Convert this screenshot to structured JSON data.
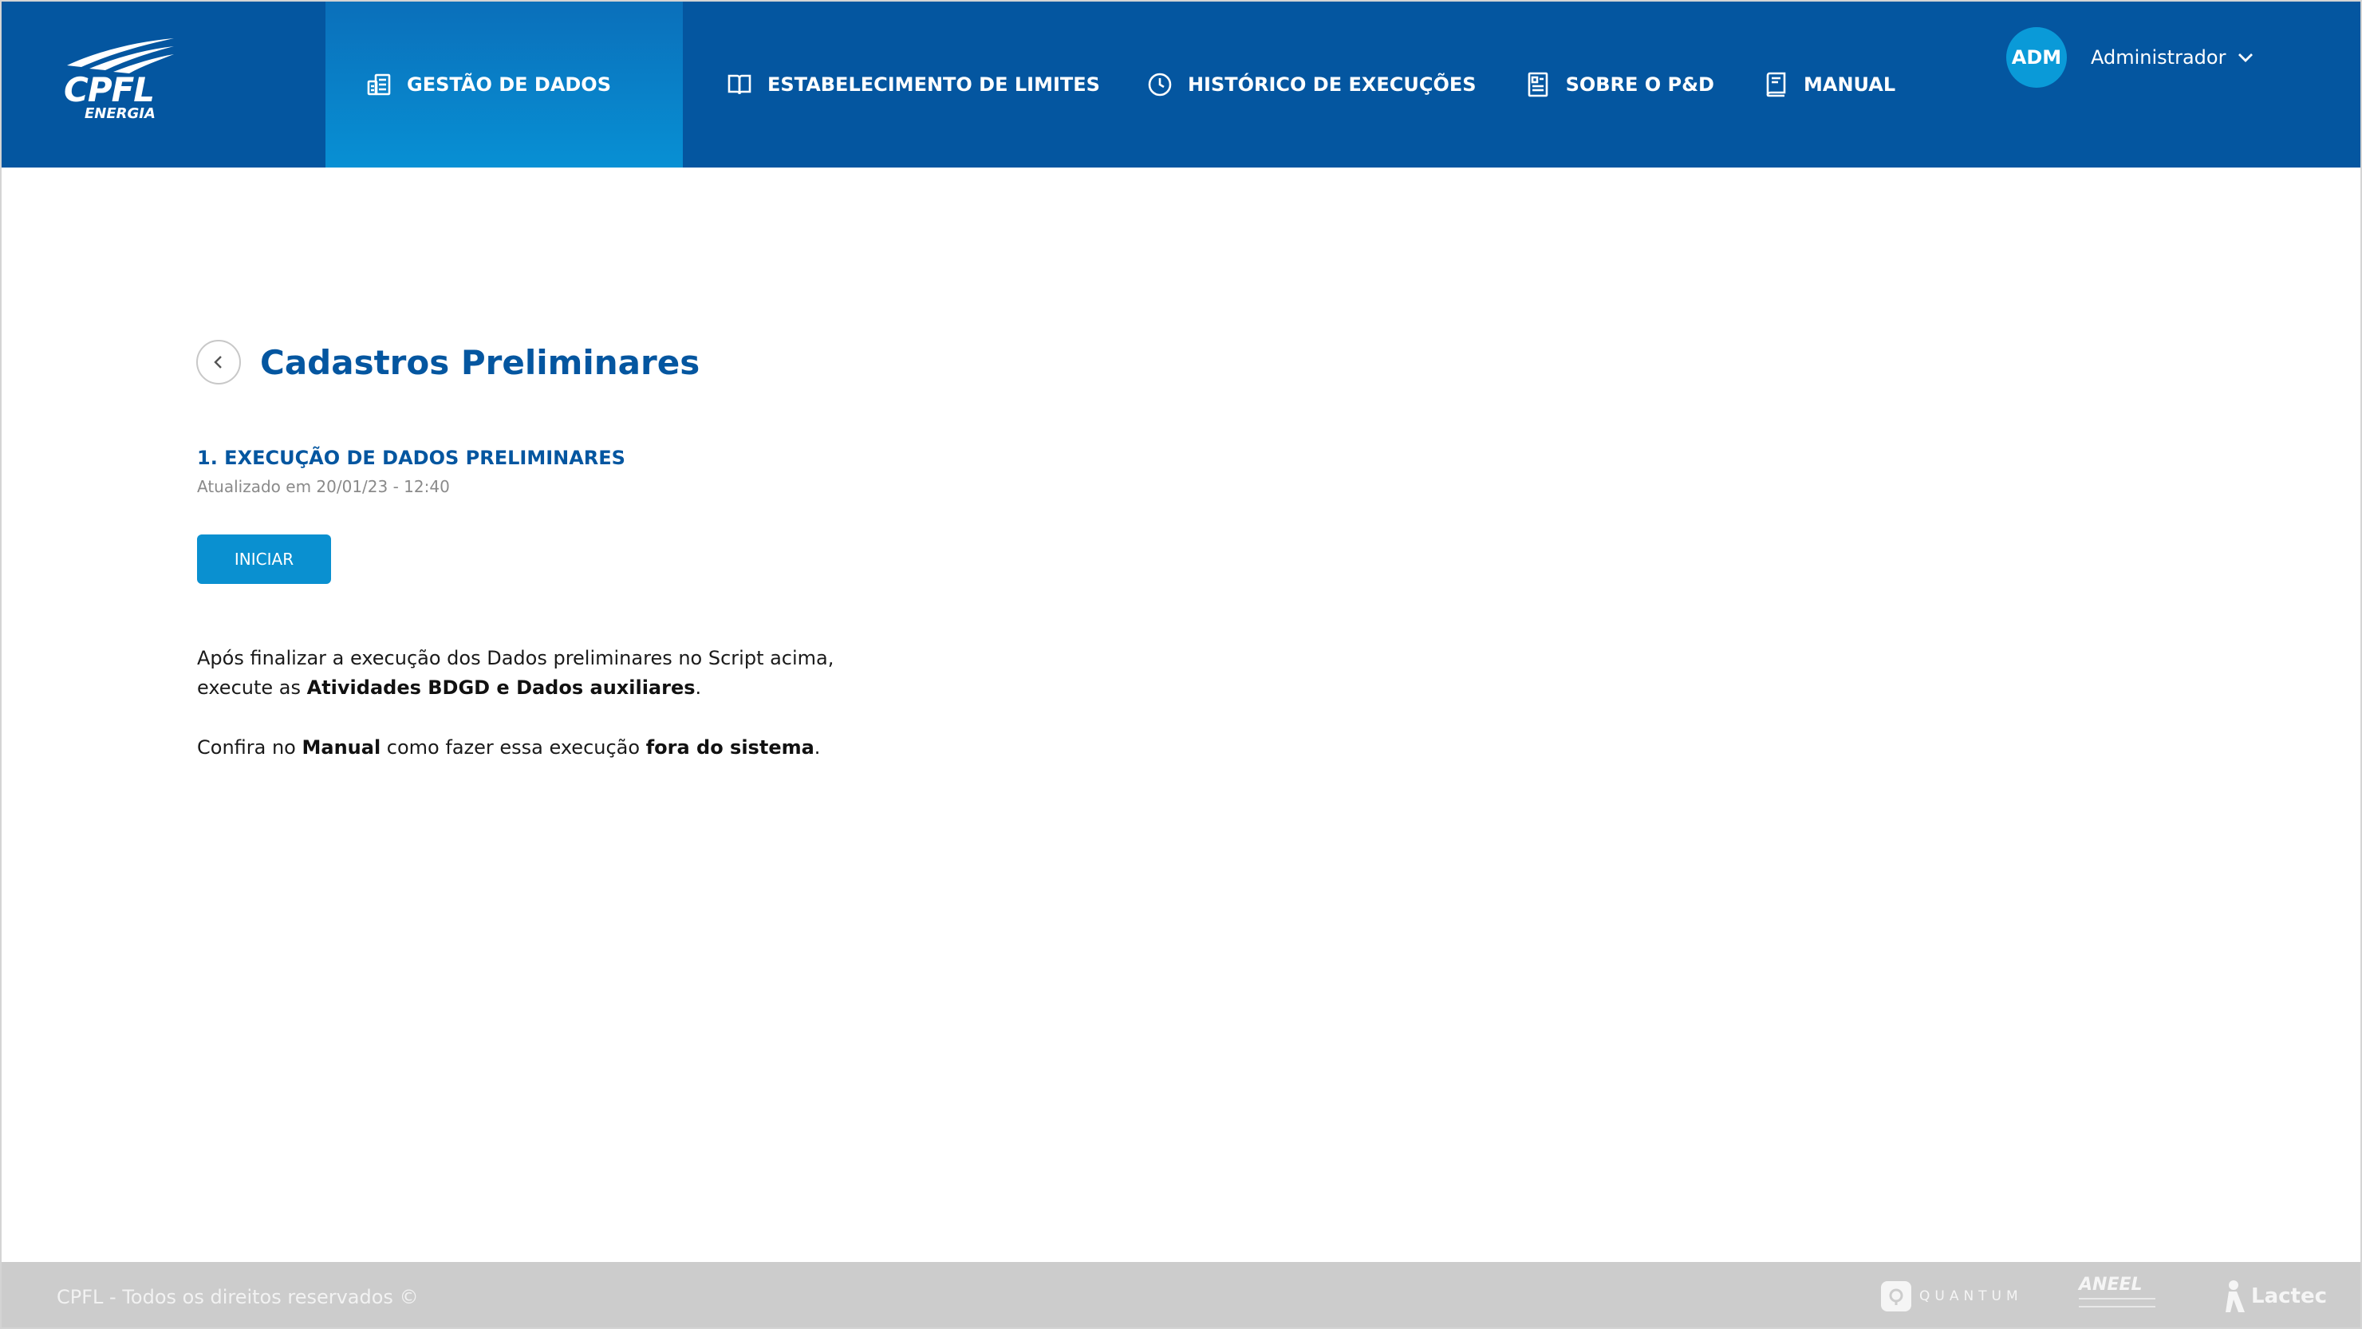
{
  "header": {
    "logo": {
      "main": "CPFL",
      "sub": "ENERGIA"
    },
    "nav": [
      {
        "label": "GESTÃO DE DADOS",
        "icon": "data-management-icon",
        "active": true
      },
      {
        "label": "ESTABELECIMENTO DE LIMITES",
        "icon": "book-open-icon",
        "active": false
      },
      {
        "label": "HISTÓRICO DE EXECUÇÕES",
        "icon": "clock-icon",
        "active": false
      },
      {
        "label": "SOBRE O P&D",
        "icon": "document-icon",
        "active": false
      },
      {
        "label": "MANUAL",
        "icon": "manual-book-icon",
        "active": false
      }
    ],
    "user": {
      "initials": "ADM",
      "name": "Administrador",
      "icon": "chevron-down-icon"
    }
  },
  "main": {
    "title": "Cadastros Preliminares",
    "section": {
      "title": "1. EXECUÇÃO DE DADOS PRELIMINARES",
      "updated": "Atualizado em 20/01/23 - 12:40",
      "button": "INICIAR"
    },
    "paragraph1": {
      "line1": "Após finalizar a execução dos Dados preliminares no Script acima,",
      "line2_prefix": "execute as ",
      "line2_bold": "Atividades BDGD e Dados auxiliares",
      "line2_suffix": "."
    },
    "paragraph2": {
      "prefix": "Confira no ",
      "bold1": "Manual",
      "middle": " como fazer essa execução ",
      "bold2": "fora do sistema",
      "suffix": "."
    }
  },
  "footer": {
    "copyright": "CPFL - Todos os direitos reservados ©",
    "partners": {
      "quantum": "QUANTUM",
      "aneel": "ANEEL",
      "lactec": "Lactec"
    }
  },
  "colors": {
    "header_bg": "#0456a0",
    "active_tab": "#0890d4",
    "accent": "#0a90d0",
    "footer_bg": "#cccccc"
  }
}
